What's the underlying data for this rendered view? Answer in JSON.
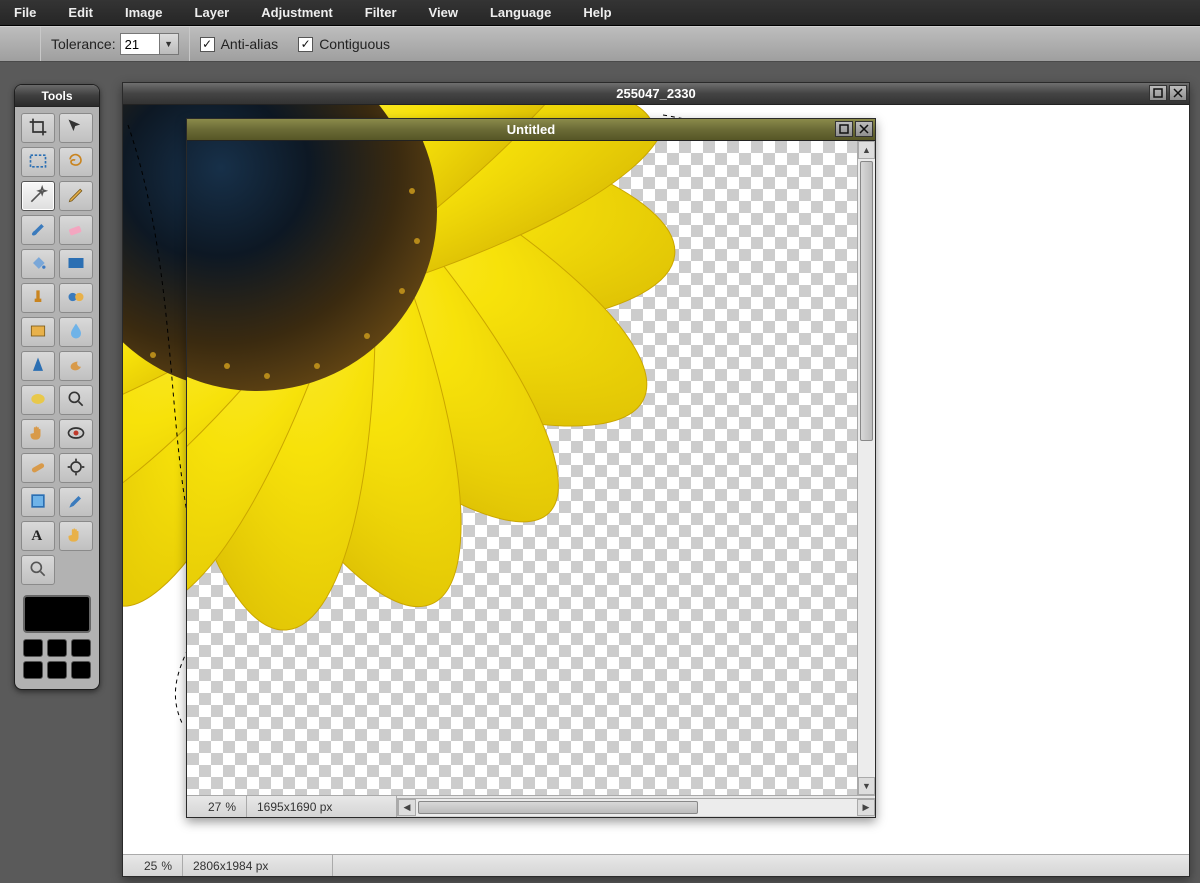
{
  "menu": {
    "items": [
      "File",
      "Edit",
      "Image",
      "Layer",
      "Adjustment",
      "Filter",
      "View",
      "Language",
      "Help"
    ]
  },
  "options": {
    "tool_icon": "magic-wand",
    "tolerance_label": "Tolerance:",
    "tolerance_value": "21",
    "antialias_label": "Anti-alias",
    "antialias_checked": true,
    "contiguous_label": "Contiguous",
    "contiguous_checked": true
  },
  "tools_panel": {
    "title": "Tools",
    "items": [
      {
        "name": "crop",
        "sel": false
      },
      {
        "name": "move",
        "sel": false
      },
      {
        "name": "rect-select",
        "sel": false
      },
      {
        "name": "lasso",
        "sel": false
      },
      {
        "name": "magic-wand",
        "sel": true
      },
      {
        "name": "pencil",
        "sel": false
      },
      {
        "name": "brush",
        "sel": false
      },
      {
        "name": "eraser",
        "sel": false
      },
      {
        "name": "fill-bucket",
        "sel": false
      },
      {
        "name": "gradient",
        "sel": false
      },
      {
        "name": "stamp",
        "sel": false
      },
      {
        "name": "color-replace",
        "sel": false
      },
      {
        "name": "shape",
        "sel": false
      },
      {
        "name": "blur",
        "sel": false
      },
      {
        "name": "sharpen",
        "sel": false
      },
      {
        "name": "smudge",
        "sel": false
      },
      {
        "name": "sponge",
        "sel": false
      },
      {
        "name": "zoom",
        "sel": false
      },
      {
        "name": "hand",
        "sel": false
      },
      {
        "name": "redeye",
        "sel": false
      },
      {
        "name": "heal",
        "sel": false
      },
      {
        "name": "dodge",
        "sel": false
      },
      {
        "name": "transform",
        "sel": false
      },
      {
        "name": "eyedropper",
        "sel": false
      },
      {
        "name": "text",
        "sel": false
      },
      {
        "name": "pan-hand",
        "sel": false
      },
      {
        "name": "magnify",
        "sel": false
      }
    ],
    "foreground_color": "#000000"
  },
  "windows": {
    "main": {
      "title": "255047_2330",
      "zoom_pct": "25",
      "pct_unit": "%",
      "dimensions": "2806x1984 px"
    },
    "sub": {
      "title": "Untitled",
      "zoom_pct": "27",
      "pct_unit": "%",
      "dimensions": "1695x1690 px"
    }
  }
}
